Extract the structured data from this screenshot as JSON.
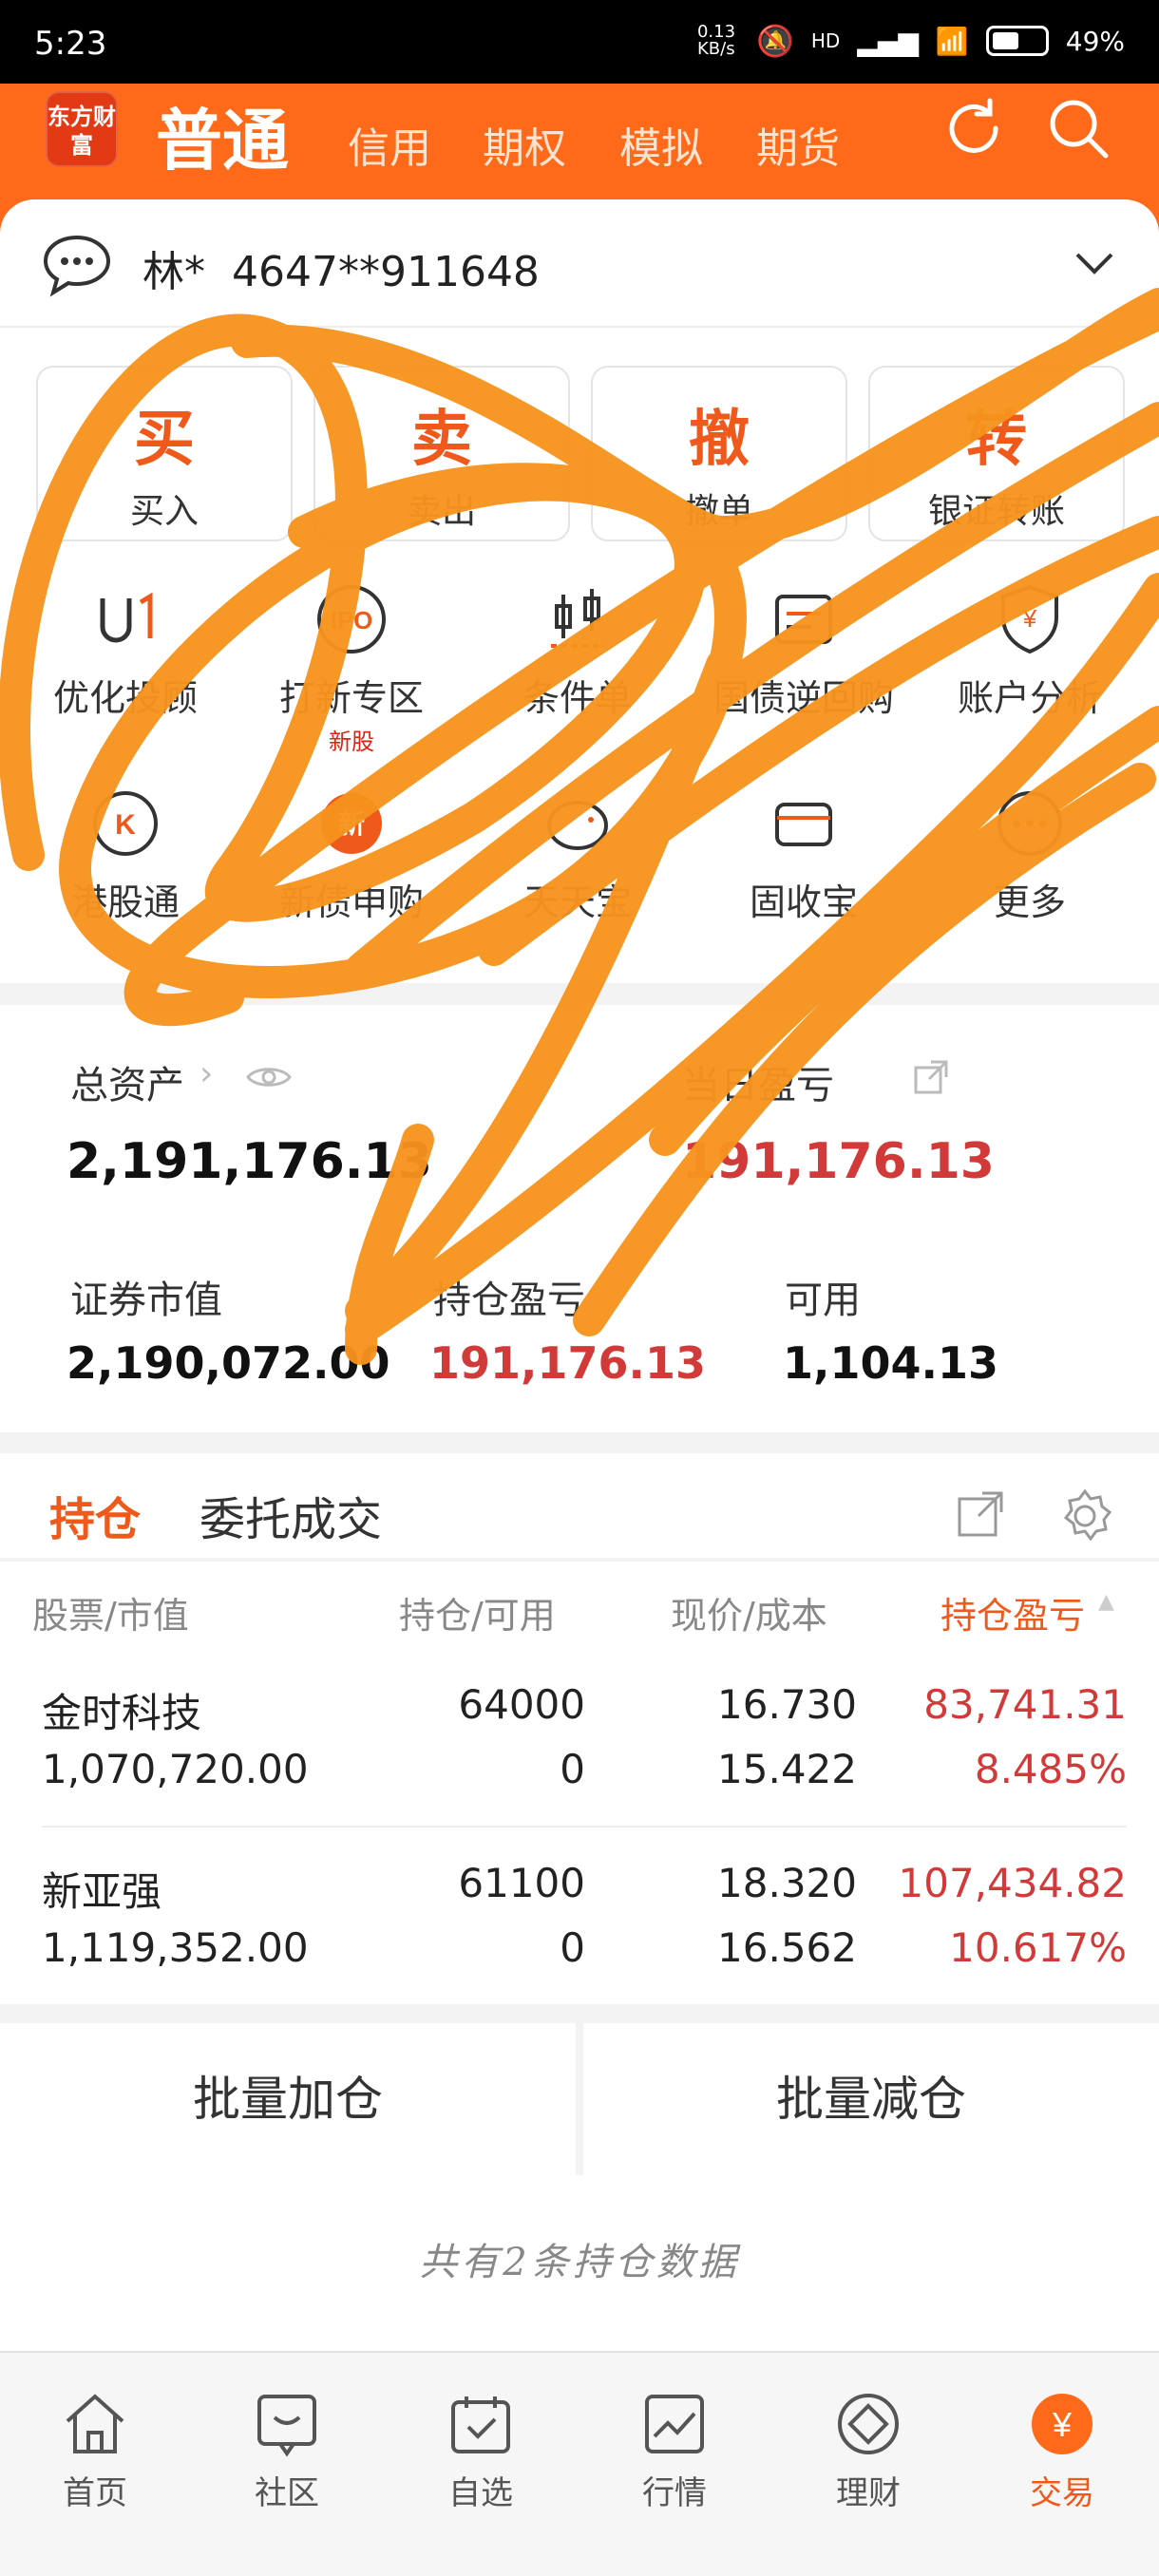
{
  "status": {
    "time": "5:23",
    "net": "0.13 KB/s",
    "signal": "HD",
    "battery": "49%"
  },
  "header": {
    "logo": "东方财富",
    "tabs": [
      "普通",
      "信用",
      "期权",
      "模拟",
      "期货"
    ],
    "icons": [
      "refresh-icon",
      "search-icon"
    ],
    "accent": "#ff6a1a"
  },
  "account": {
    "name": "林*",
    "number": "4647**911648"
  },
  "actions": [
    {
      "key": "买",
      "label": "买入"
    },
    {
      "key": "卖",
      "label": "卖出"
    },
    {
      "key": "撤",
      "label": "撤单"
    },
    {
      "key": "转",
      "label": "银证转账"
    }
  ],
  "tools": [
    {
      "label": "优化投顾",
      "icon": "advisor-icon"
    },
    {
      "label": "打新专区",
      "sub": "新股",
      "icon": "ipo-icon"
    },
    {
      "label": "条件单",
      "icon": "candlestick-icon"
    },
    {
      "label": "国债逆回购",
      "icon": "bond-icon"
    },
    {
      "label": "账户分析",
      "icon": "yuan-shield-icon"
    },
    {
      "label": "港股通",
      "icon": "hk-icon"
    },
    {
      "label": "新债申购",
      "icon": "new-bond-icon"
    },
    {
      "label": "天天宝",
      "icon": "piggy-icon"
    },
    {
      "label": "固收宝",
      "icon": "fixed-income-icon"
    },
    {
      "label": "更多",
      "icon": "more-icon"
    }
  ],
  "assets": {
    "total_label": "总资产",
    "total_value": "2,191,176.13",
    "daily_label": "当日盈亏",
    "daily_value": "191,176.13",
    "market_label": "证券市值",
    "market_value": "2,190,072.00",
    "pnl_label": "持仓盈亏",
    "pnl_value": "191,176.13",
    "avail_label": "可用",
    "avail_value": "1,104.13"
  },
  "holdings": {
    "tabs": [
      "持仓",
      "委托成交"
    ],
    "columns": [
      "股票/市值",
      "持仓/可用",
      "现价/成本",
      "持仓盈亏"
    ],
    "rows": [
      {
        "name": "金时科技",
        "market_value": "1,070,720.00",
        "position": "64000",
        "available": "0",
        "price": "16.730",
        "cost": "15.422",
        "pnl": "83,741.31",
        "pnl_pct": "8.485%"
      },
      {
        "name": "新亚强",
        "market_value": "1,119,352.00",
        "position": "61100",
        "available": "0",
        "price": "18.320",
        "cost": "16.562",
        "pnl": "107,434.82",
        "pnl_pct": "10.617%"
      }
    ]
  },
  "batch": {
    "add": "批量加仓",
    "reduce": "批量减仓"
  },
  "footer_note": "共有2条持仓数据",
  "nav": [
    {
      "label": "首页",
      "icon": "home-icon"
    },
    {
      "label": "社区",
      "icon": "community-icon"
    },
    {
      "label": "自选",
      "icon": "watchlist-icon"
    },
    {
      "label": "行情",
      "icon": "market-chart-icon"
    },
    {
      "label": "理财",
      "icon": "wealth-icon"
    },
    {
      "label": "交易",
      "icon": "trade-yuan-icon"
    }
  ]
}
